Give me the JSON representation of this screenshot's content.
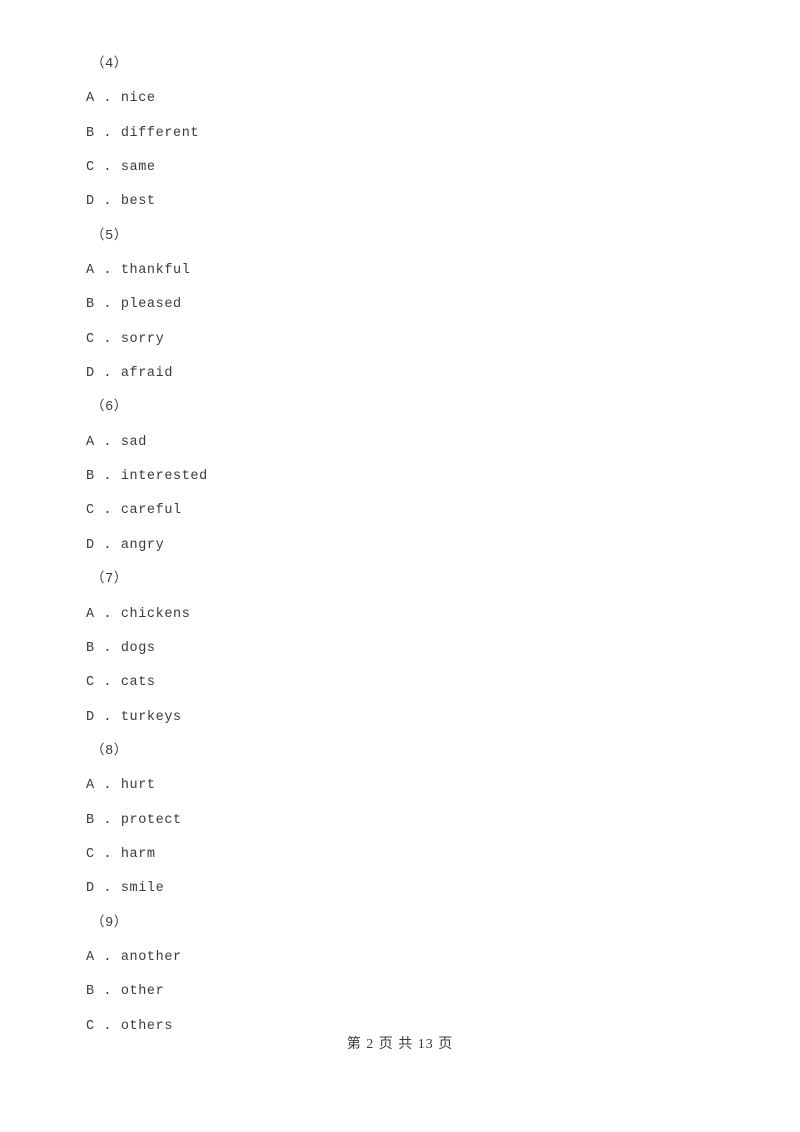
{
  "document": {
    "page_background": "#ffffff",
    "text_color": "#3b3b3b"
  },
  "questions": [
    {
      "number": "（4）",
      "options": [
        {
          "letter": "A",
          "separator": " . ",
          "text": "nice"
        },
        {
          "letter": "B",
          "separator": " . ",
          "text": "different"
        },
        {
          "letter": "C",
          "separator": " . ",
          "text": "same"
        },
        {
          "letter": "D",
          "separator": " . ",
          "text": "best"
        }
      ]
    },
    {
      "number": "（5）",
      "options": [
        {
          "letter": "A",
          "separator": " . ",
          "text": "thankful"
        },
        {
          "letter": "B",
          "separator": " . ",
          "text": "pleased"
        },
        {
          "letter": "C",
          "separator": " . ",
          "text": "sorry"
        },
        {
          "letter": "D",
          "separator": " . ",
          "text": "afraid"
        }
      ]
    },
    {
      "number": "（6）",
      "options": [
        {
          "letter": "A",
          "separator": " . ",
          "text": "sad"
        },
        {
          "letter": "B",
          "separator": " . ",
          "text": "interested"
        },
        {
          "letter": "C",
          "separator": " . ",
          "text": "careful"
        },
        {
          "letter": "D",
          "separator": " . ",
          "text": "angry"
        }
      ]
    },
    {
      "number": "（7）",
      "options": [
        {
          "letter": "A",
          "separator": " . ",
          "text": "chickens"
        },
        {
          "letter": "B",
          "separator": " . ",
          "text": "dogs"
        },
        {
          "letter": "C",
          "separator": " . ",
          "text": "cats"
        },
        {
          "letter": "D",
          "separator": " . ",
          "text": "turkeys"
        }
      ]
    },
    {
      "number": "（8）",
      "options": [
        {
          "letter": "A",
          "separator": " . ",
          "text": "hurt"
        },
        {
          "letter": "B",
          "separator": " . ",
          "text": "protect"
        },
        {
          "letter": "C",
          "separator": " . ",
          "text": "harm"
        },
        {
          "letter": "D",
          "separator": " . ",
          "text": "smile"
        }
      ]
    },
    {
      "number": "（9）",
      "options": [
        {
          "letter": "A",
          "separator": " . ",
          "text": "another"
        },
        {
          "letter": "B",
          "separator": " . ",
          "text": "other"
        },
        {
          "letter": "C",
          "separator": " . ",
          "text": "others"
        }
      ]
    }
  ],
  "footer": {
    "text": "第 2 页 共 13 页",
    "current_page": "2",
    "total_pages": "13"
  }
}
